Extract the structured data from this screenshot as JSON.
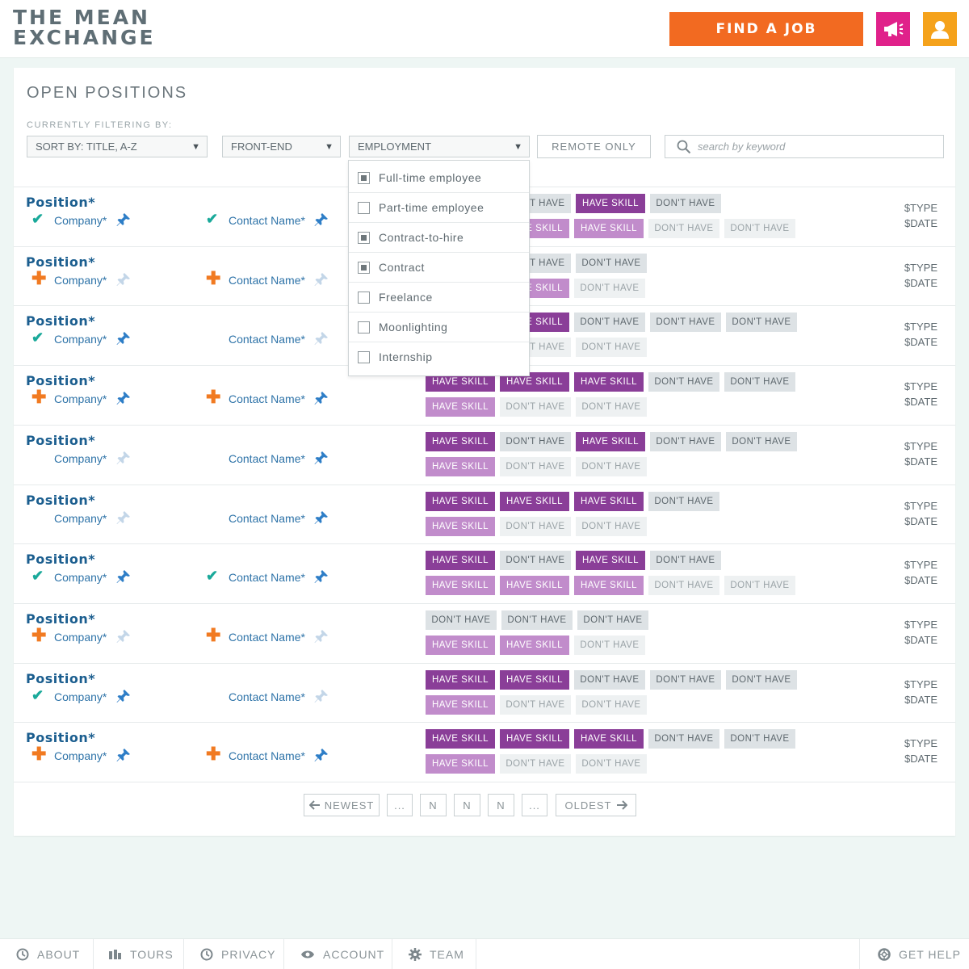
{
  "header": {
    "logo_line1": "THE MEAN",
    "logo_line2": "EXCHANGE",
    "find_job_label": "FIND A JOB",
    "accent_orange": "#f26a21",
    "accent_pink": "#e0218a",
    "accent_amber": "#f5a21b"
  },
  "panel": {
    "title": "OPEN POSITIONS",
    "filter_label": "CURRENTLY FILTERING BY:",
    "sort_select": "SORT BY: TITLE, A-Z",
    "category_select": "FRONT-END",
    "employment_select": "EMPLOYMENT",
    "remote_button": "REMOTE ONLY",
    "search_placeholder": "search by keyword"
  },
  "employment_options": [
    {
      "label": "Full-time employee",
      "checked": true
    },
    {
      "label": "Part-time employee",
      "checked": false
    },
    {
      "label": "Contract-to-hire",
      "checked": true
    },
    {
      "label": "Contract",
      "checked": true
    },
    {
      "label": "Freelance",
      "checked": false
    },
    {
      "label": "Moonlighting",
      "checked": false
    },
    {
      "label": "Internship",
      "checked": false
    }
  ],
  "labels": {
    "position": "Position*",
    "company": "Company*",
    "contact": "Contact Name*",
    "type": "$TYPE",
    "date": "$DATE",
    "have": "HAVE SKILL",
    "dont": "DON'T HAVE"
  },
  "rows": [
    {
      "company_mark": "check",
      "company_pin": true,
      "contact_mark": "check",
      "contact_pin": true,
      "skills1": [
        "hd",
        "dd",
        "hd",
        "dd"
      ],
      "skills2": [
        "hl",
        "hl",
        "hl",
        "dl",
        "dl"
      ]
    },
    {
      "company_mark": "plus",
      "company_pin": false,
      "contact_mark": "plus",
      "contact_pin": false,
      "skills1": [
        "hd",
        "dd",
        "dd"
      ],
      "skills2": [
        "hl",
        "hl",
        "dl"
      ]
    },
    {
      "company_mark": "check",
      "company_pin": true,
      "contact_mark": "none",
      "contact_pin": false,
      "skills1": [
        "hd",
        "hd",
        "dd",
        "dd",
        "dd"
      ],
      "skills2": [
        "hl",
        "dl",
        "dl"
      ]
    },
    {
      "company_mark": "plus",
      "company_pin": true,
      "contact_mark": "plus",
      "contact_pin": true,
      "skills1": [
        "hd",
        "hd",
        "hd",
        "dd",
        "dd"
      ],
      "skills2": [
        "hl",
        "dl",
        "dl"
      ]
    },
    {
      "company_mark": "none",
      "company_pin": false,
      "contact_mark": "none",
      "contact_pin": true,
      "skills1": [
        "hd",
        "dd",
        "hd",
        "dd",
        "dd"
      ],
      "skills2": [
        "hl",
        "dl",
        "dl"
      ]
    },
    {
      "company_mark": "none",
      "company_pin": false,
      "contact_mark": "none",
      "contact_pin": true,
      "skills1": [
        "hd",
        "hd",
        "hd",
        "dd"
      ],
      "skills2": [
        "hl",
        "dl",
        "dl"
      ]
    },
    {
      "company_mark": "check",
      "company_pin": true,
      "contact_mark": "check",
      "contact_pin": true,
      "skills1": [
        "hd",
        "dd",
        "hd",
        "dd"
      ],
      "skills2": [
        "hl",
        "hl",
        "hl",
        "dl",
        "dl"
      ]
    },
    {
      "company_mark": "plus",
      "company_pin": false,
      "contact_mark": "plus",
      "contact_pin": false,
      "skills1": [
        "dd",
        "dd",
        "dd"
      ],
      "skills2": [
        "hl",
        "hl",
        "dl"
      ]
    },
    {
      "company_mark": "check",
      "company_pin": true,
      "contact_mark": "none",
      "contact_pin": false,
      "skills1": [
        "hd",
        "hd",
        "dd",
        "dd",
        "dd"
      ],
      "skills2": [
        "hl",
        "dl",
        "dl"
      ]
    },
    {
      "company_mark": "plus",
      "company_pin": true,
      "contact_mark": "plus",
      "contact_pin": true,
      "skills1": [
        "hd",
        "hd",
        "hd",
        "dd",
        "dd"
      ],
      "skills2": [
        "hl",
        "dl",
        "dl"
      ]
    }
  ],
  "pagination": {
    "newest": "NEWEST",
    "ellipsis": "...",
    "page": "N",
    "oldest": "OLDEST"
  },
  "footer": {
    "about": "ABOUT",
    "tours": "TOURS",
    "privacy": "PRIVACY",
    "account": "ACCOUNT",
    "team": "TEAM",
    "help": "GET HELP"
  }
}
